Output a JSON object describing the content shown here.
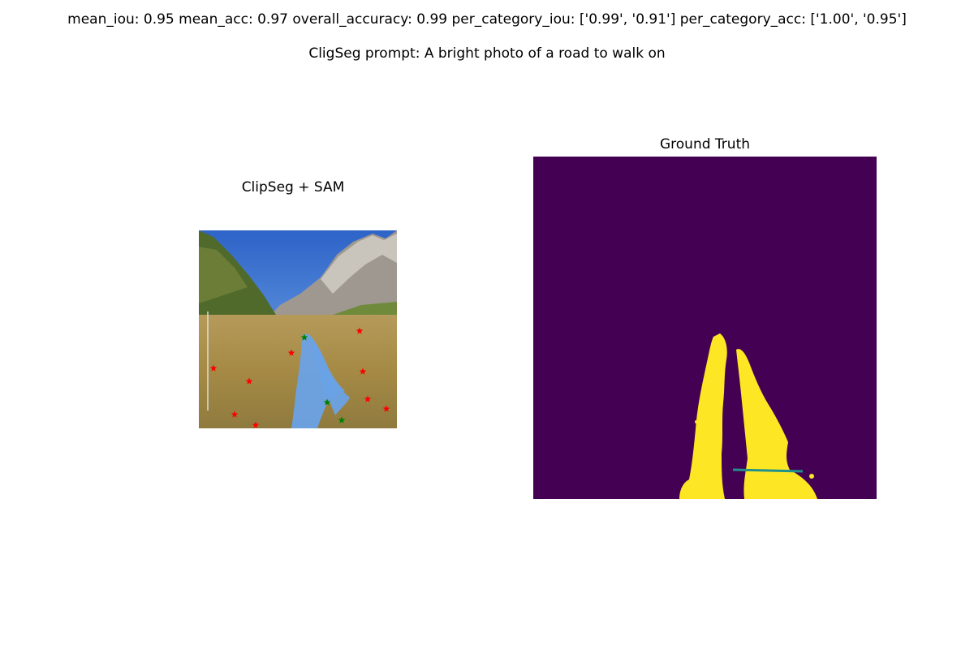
{
  "header": {
    "metrics": "mean_iou: 0.95  mean_acc: 0.97  overall_accuracy: 0.99  per_category_iou: ['0.99', '0.91']  per_category_acc: ['1.00', '0.95']",
    "prompt": "CligSeg prompt: A bright photo of a road to walk on"
  },
  "panels": {
    "left_title": "ClipSeg + SAM",
    "right_title": "Ground Truth"
  },
  "colors": {
    "mask_background": "#440154",
    "mask_foreground": "#fde725",
    "mask_edge": "#21918c",
    "segment_overlay": "#6aa2e6",
    "positive_point": "#008000",
    "negative_point": "#ff0000"
  },
  "icons": {
    "positive_point": "green-star-icon",
    "negative_point": "red-star-icon"
  }
}
